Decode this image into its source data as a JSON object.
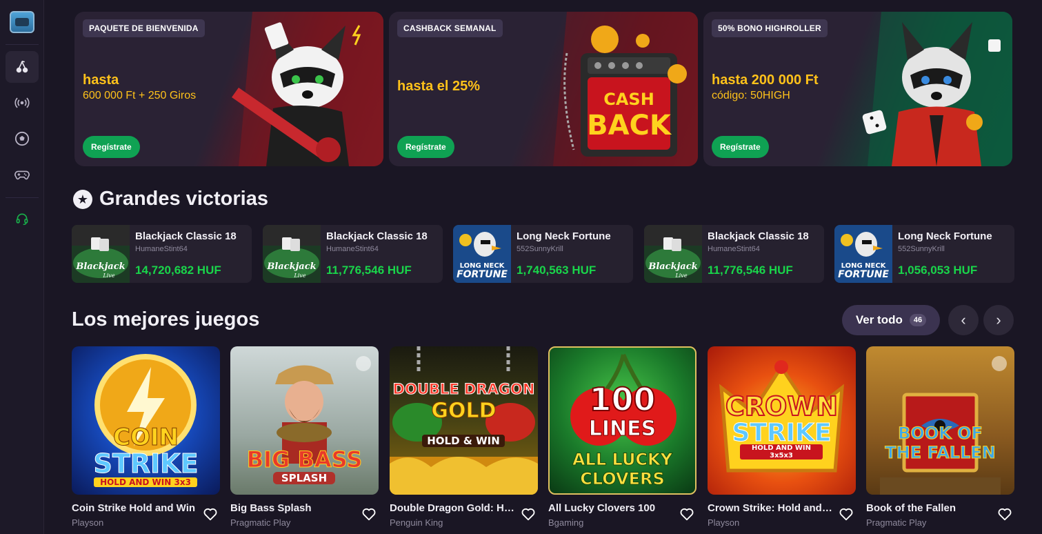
{
  "sidebar": {
    "items": [
      {
        "icon": "cherry-icon"
      },
      {
        "icon": "live-broadcast-icon"
      },
      {
        "icon": "soccer-ball-icon"
      },
      {
        "icon": "gamepad-icon"
      },
      {
        "icon": "headset-icon"
      }
    ]
  },
  "banners": [
    {
      "tag": "PAQUETE DE BIENVENIDA",
      "line1": "hasta",
      "line2": "600 000 Ft + 250 Giros",
      "cta": "Regístrate"
    },
    {
      "tag": "CASHBACK SEMANAL",
      "line1": "hasta el 25%",
      "line2": "",
      "cta": "Regístrate",
      "art_text_1": "CASH",
      "art_text_2": "BACK"
    },
    {
      "tag": "50% BONO HIGHROLLER",
      "line1": "hasta 200 000 Ft",
      "line2": "código: 50HIGH",
      "cta": "Regístrate"
    }
  ],
  "big_wins": {
    "title": "Grandes victorias",
    "items": [
      {
        "game": "Blackjack Classic 18",
        "user": "HumaneStint64",
        "amount": "14,720,682 HUF",
        "thumb": "blackjack"
      },
      {
        "game": "Blackjack Classic 18",
        "user": "HumaneStint64",
        "amount": "11,776,546 HUF",
        "thumb": "blackjack"
      },
      {
        "game": "Long Neck Fortune",
        "user": "552SunnyKrill",
        "amount": "1,740,563 HUF",
        "thumb": "longneck"
      },
      {
        "game": "Blackjack Classic 18",
        "user": "HumaneStint64",
        "amount": "11,776,546 HUF",
        "thumb": "blackjack"
      },
      {
        "game": "Long Neck Fortune",
        "user": "552SunnyKrill",
        "amount": "1,056,053 HUF",
        "thumb": "longneck"
      }
    ],
    "thumb_text": {
      "blackjack": "Blackjack",
      "blackjack_sub": "Live",
      "longneck_1": "LONG NECK",
      "longneck_2": "FORTUNE"
    }
  },
  "top_games": {
    "title": "Los mejores juegos",
    "view_all_label": "Ver todo",
    "view_all_count": "46",
    "prev_icon": "chevron-left-icon",
    "next_icon": "chevron-right-icon",
    "games": [
      {
        "title": "Coin Strike Hold and Win",
        "provider": "Playson",
        "art_1": "COIN",
        "art_2": "STRIKE",
        "art_3": "HOLD AND WIN 3x3"
      },
      {
        "title": "Big Bass Splash",
        "provider": "Pragmatic Play",
        "art_1": "BIG BASS",
        "art_2": "SPLASH",
        "art_3": ""
      },
      {
        "title": "Double Dragon Gold: Hol...",
        "provider": "Penguin King",
        "art_1": "DOUBLE DRAGON",
        "art_2": "GOLD",
        "art_3": "HOLD & WIN"
      },
      {
        "title": "All Lucky Clovers 100",
        "provider": "Bgaming",
        "art_1": "100",
        "art_2": "LINES",
        "art_3": "ALL LUCKY CLOVERS"
      },
      {
        "title": "Crown Strike: Hold and ...",
        "provider": "Playson",
        "art_1": "CROWN",
        "art_2": "STRIKE",
        "art_3": "HOLD AND WIN 3x5x3"
      },
      {
        "title": "Book of the Fallen",
        "provider": "Pragmatic Play",
        "art_1": "BOOK OF",
        "art_2": "THE FALLEN",
        "art_3": ""
      }
    ]
  }
}
